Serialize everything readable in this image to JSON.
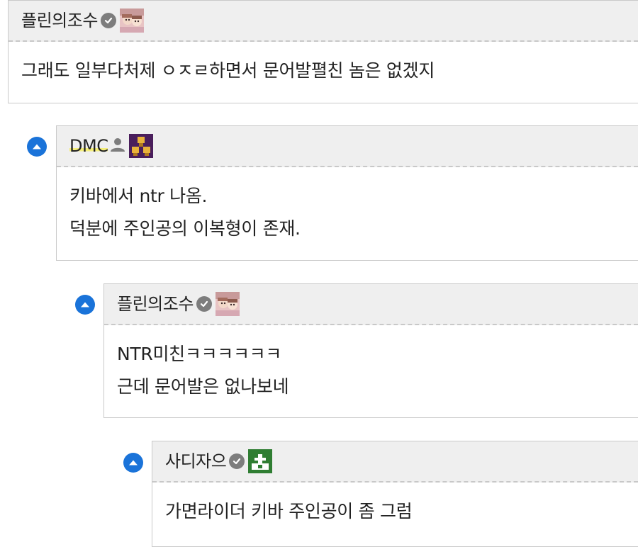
{
  "thread": {
    "comments": [
      {
        "author": "플린의조수",
        "verified_icon": "check-circle-icon",
        "avatar_icon": "anime-girl-avatar",
        "lines": [
          "그래도 일부다처제 ㅇㅈㄹ하면서 문어발펼친 놈은 없겠지"
        ]
      },
      {
        "author": "DMC",
        "user_icon": "person-icon",
        "avatar_icon": "pixel-pyramid-avatar",
        "lines": [
          "키바에서 ntr 나옴.",
          "덕분에 주인공의 이복형이 존재."
        ]
      },
      {
        "author": "플린의조수",
        "verified_icon": "check-circle-icon",
        "avatar_icon": "anime-girl-avatar",
        "lines": [
          "NTR미친ㅋㅋㅋㅋㅋㅋ",
          "근데 문어발은 없나보네"
        ]
      },
      {
        "author": "사디자으",
        "verified_icon": "check-circle-icon",
        "avatar_icon": "pixel-green-avatar",
        "lines": [
          "가면라이더 키바 주인공이 좀 그럼"
        ]
      }
    ]
  },
  "colors": {
    "collapse_button": "#1a73d9",
    "header_bg": "#efefef",
    "border": "#c9c9c9",
    "highlight": "#f4ee7a"
  }
}
